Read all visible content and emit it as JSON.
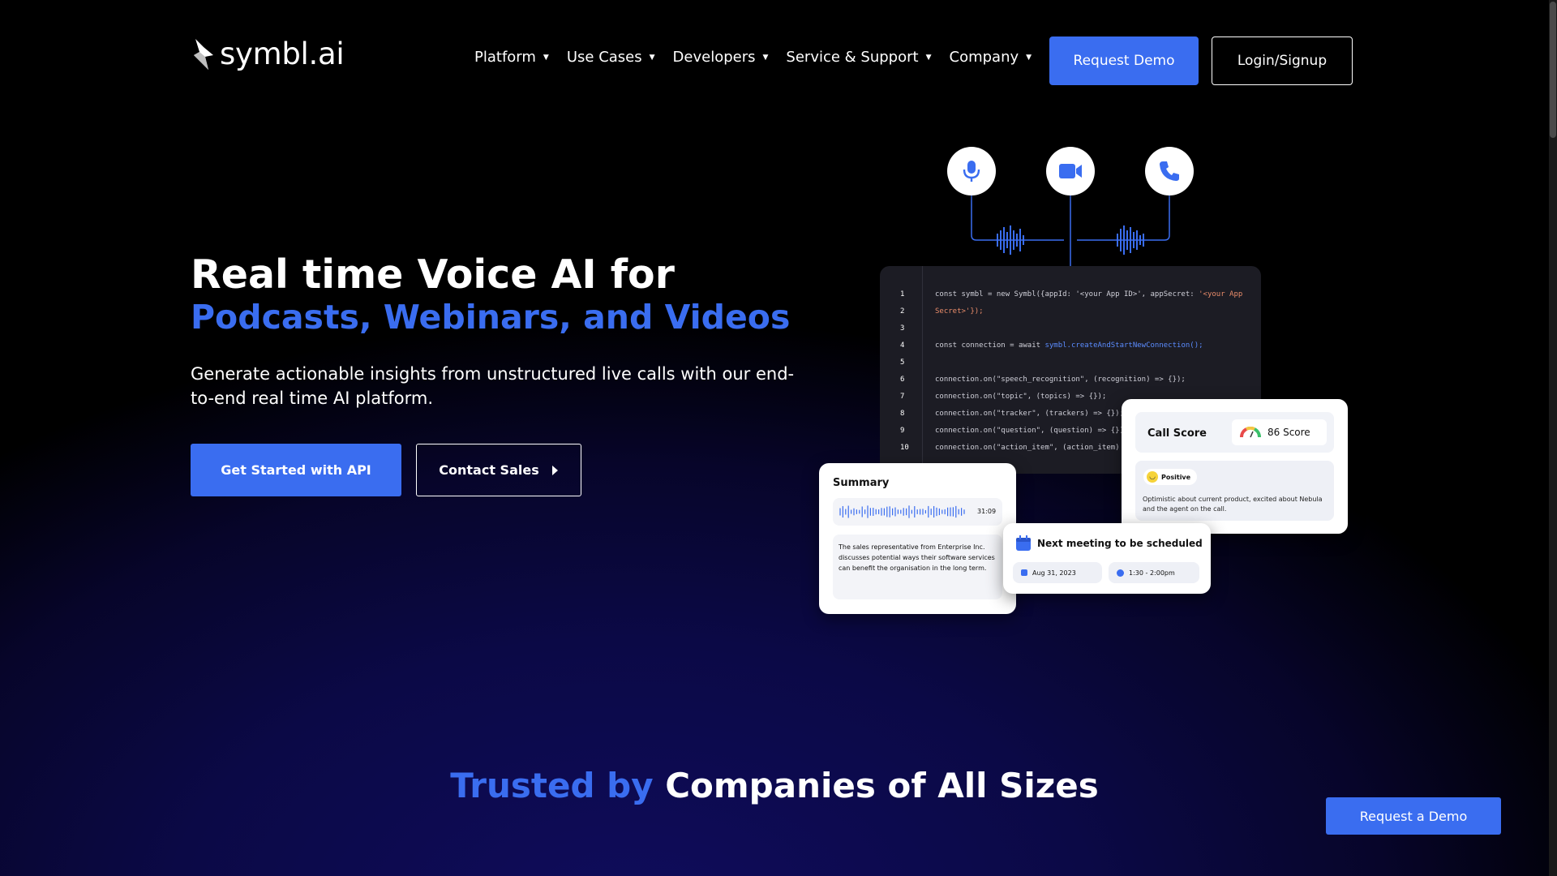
{
  "brand": {
    "name": "symbl.ai"
  },
  "nav": {
    "items": [
      {
        "label": "Platform"
      },
      {
        "label": "Use Cases"
      },
      {
        "label": "Developers"
      },
      {
        "label": "Service & Support"
      },
      {
        "label": "Company"
      }
    ],
    "request_demo": "Request Demo",
    "login": "Login/Signup"
  },
  "hero": {
    "title_line1": "Real time Voice AI for",
    "title_line2": "Podcasts, Webinars, and Videos",
    "subtitle": "Generate actionable insights from unstructured live calls with our end-to-end real time AI platform.",
    "cta_primary": "Get Started with API",
    "cta_secondary": "Contact Sales"
  },
  "illustration": {
    "icons": [
      "microphone-icon",
      "video-camera-icon",
      "phone-icon"
    ],
    "code": [
      {
        "n": "1",
        "text": "const symbl = new Symbl({appId: '<your App ID>', appSecret: ",
        "str": "'<your App"
      },
      {
        "n": "",
        "text": "",
        "str": "Secret>'});"
      },
      {
        "n": "2",
        "text": "",
        "str": ""
      },
      {
        "n": "3",
        "text": "",
        "str": ""
      },
      {
        "n": "4",
        "text": "const connection = await ",
        "fn": "symbl.createAndStartNewConnection();"
      },
      {
        "n": "5",
        "text": "",
        "str": ""
      },
      {
        "n": "6",
        "text": "connection.on(\"speech_recognition\", (recognition) => {});"
      },
      {
        "n": "7",
        "text": "connection.on(\"topic\", (topics) => {});"
      },
      {
        "n": "8",
        "text": "connection.on(\"tracker\", (trackers) => {});"
      },
      {
        "n": "9",
        "text": "connection.on(\"question\", (question) => {});"
      },
      {
        "n": "10",
        "text": "connection.on(\"action_item\", (action_item) => {});"
      }
    ],
    "summary": {
      "title": "Summary",
      "duration": "31:09",
      "text": "The sales representative from Enterprise Inc. discusses potential ways their software services can benefit the organisation in the long term."
    },
    "call_score": {
      "title": "Call Score",
      "score": "86 Score",
      "sentiment": "Positive",
      "note": "Optimistic about current product, excited about Nebula and the agent on the call."
    },
    "meeting": {
      "title": "Next meeting to be scheduled",
      "date": "Aug 31, 2023",
      "time": "1:30 - 2:00pm"
    }
  },
  "trusted": {
    "highlight": "Trusted by",
    "rest": "Companies of All Sizes"
  },
  "floating_cta": "Request a Demo",
  "colors": {
    "accent": "#3a6df0",
    "background": "#000000"
  }
}
